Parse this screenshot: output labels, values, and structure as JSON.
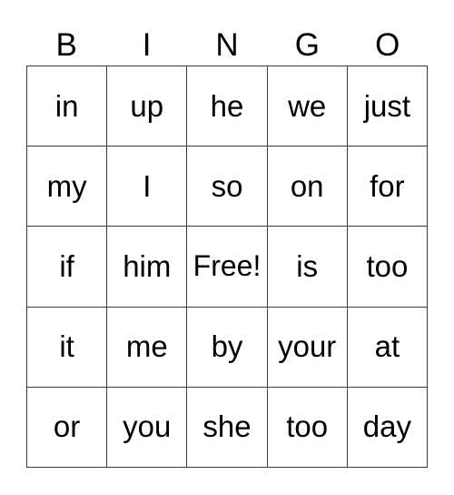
{
  "header": [
    "B",
    "I",
    "N",
    "G",
    "O"
  ],
  "rows": [
    [
      "in",
      "up",
      "he",
      "we",
      "just"
    ],
    [
      "my",
      "I",
      "so",
      "on",
      "for"
    ],
    [
      "if",
      "him",
      "Free!",
      "is",
      "too"
    ],
    [
      "it",
      "me",
      "by",
      "your",
      "at"
    ],
    [
      "or",
      "you",
      "she",
      "too",
      "day"
    ]
  ]
}
